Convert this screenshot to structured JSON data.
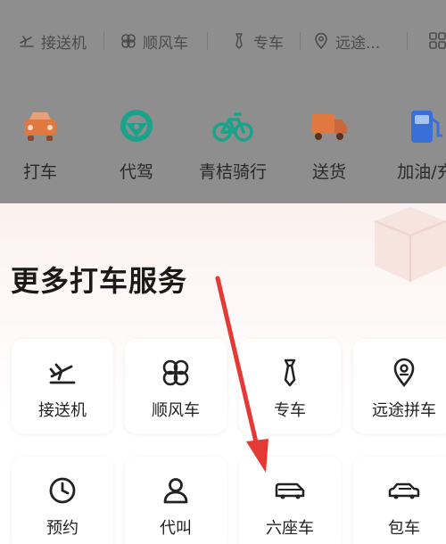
{
  "top_tabs": [
    {
      "label": "接送机",
      "icon": "airport-icon"
    },
    {
      "label": "顺风车",
      "icon": "carpool-icon"
    },
    {
      "label": "专车",
      "icon": "tie-icon"
    },
    {
      "label": "远途...",
      "icon": "location-icon"
    }
  ],
  "services": [
    {
      "label": "打车",
      "icon": "taxi-icon",
      "color": "#e0793f"
    },
    {
      "label": "代驾",
      "icon": "steering-wheel-icon",
      "color": "#1aa28a"
    },
    {
      "label": "青桔骑行",
      "icon": "bicycle-icon",
      "color": "#1aa28a"
    },
    {
      "label": "送货",
      "icon": "truck-icon",
      "color": "#e0793f"
    },
    {
      "label": "加油/充",
      "icon": "fuel-icon",
      "color": "#3a6fd8"
    }
  ],
  "more_services": {
    "title": "更多打车服务",
    "items": [
      {
        "label": "接送机",
        "icon": "airport-icon"
      },
      {
        "label": "顺风车",
        "icon": "carpool-icon"
      },
      {
        "label": "专车",
        "icon": "tie-icon"
      },
      {
        "label": "远途拼车",
        "icon": "location-icon"
      },
      {
        "label": "预约",
        "icon": "clock-icon"
      },
      {
        "label": "代叫",
        "icon": "person-icon"
      },
      {
        "label": "六座车",
        "icon": "van-icon"
      },
      {
        "label": "包车",
        "icon": "sedan-icon"
      }
    ]
  },
  "colors": {
    "dim_overlay": "#8e8e8e",
    "annotation_arrow": "#e53935"
  }
}
